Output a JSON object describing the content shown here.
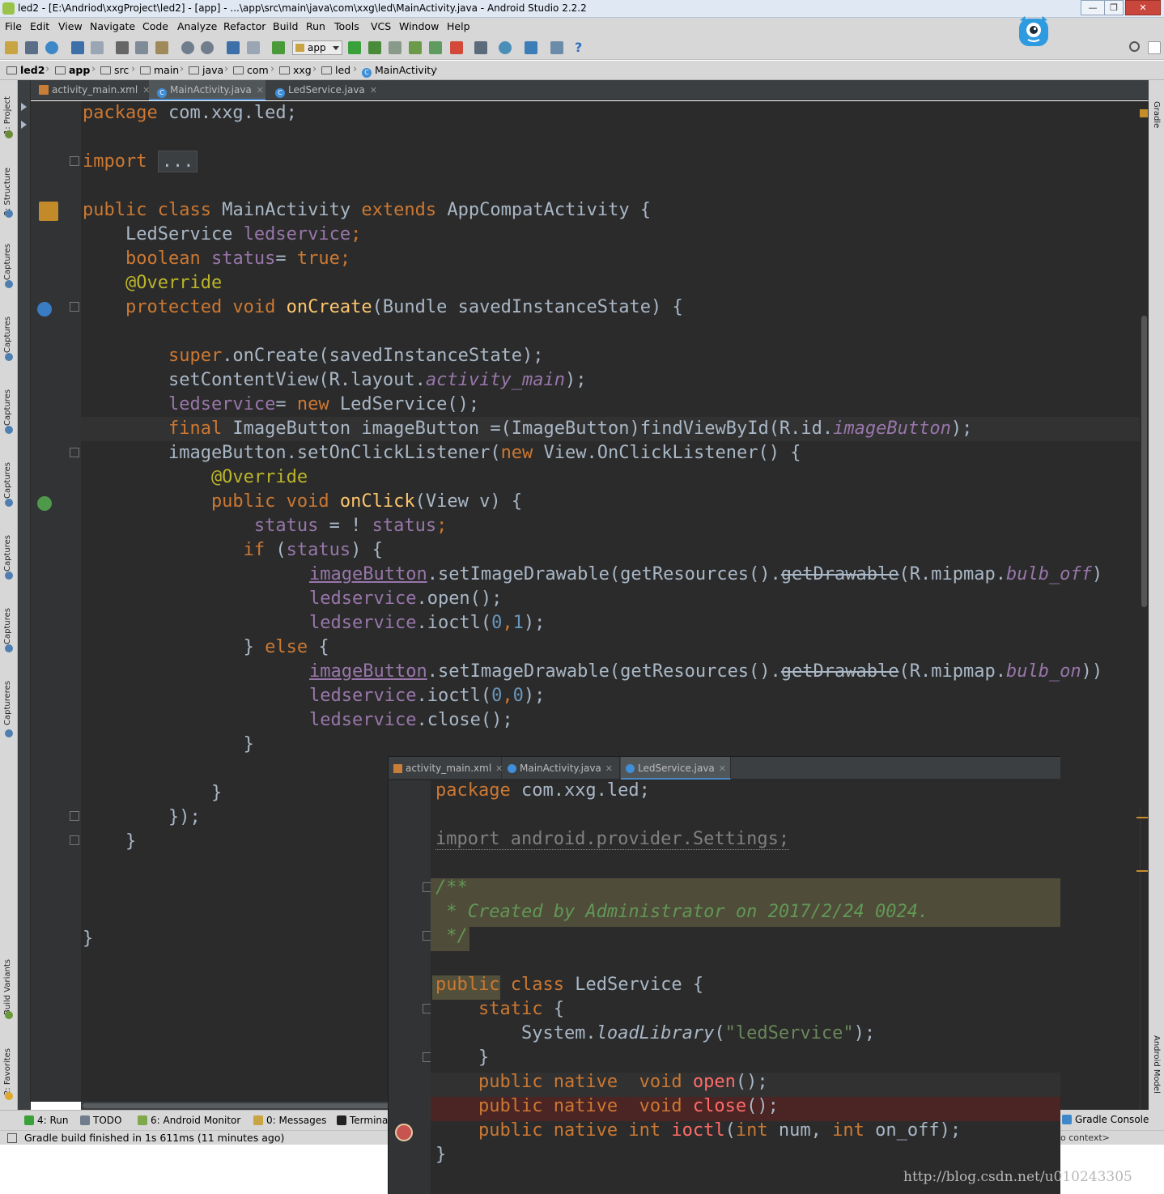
{
  "window": {
    "title": "led2 - [E:\\Andriod\\xxgProject\\led2] - [app] - ...\\app\\src\\main\\java\\com\\xxg\\led\\MainActivity.java - Android Studio 2.2.2",
    "min_label": "—",
    "max_label": "❐",
    "close_label": "✕"
  },
  "menu": [
    "File",
    "Edit",
    "View",
    "Navigate",
    "Code",
    "Analyze",
    "Refactor",
    "Build",
    "Run",
    "Tools",
    "VCS",
    "Window",
    "Help"
  ],
  "toolbar": {
    "config_select": "app",
    "icons": [
      "open-icon",
      "save-icon",
      "sync-icon",
      "undo-icon",
      "redo-icon",
      "cut-icon",
      "copy-icon",
      "paste-icon",
      "find-icon",
      "replace-icon",
      "back-icon",
      "forward-icon",
      "make-icon",
      "run-icon",
      "debug-icon",
      "coverage-icon",
      "apply-changes-icon",
      "attach-debugger-icon",
      "stop-icon",
      "avd-manager-icon",
      "sdk-manager-icon",
      "sync-gradle-icon",
      "project-structure-icon",
      "device-monitor-icon",
      "help-icon",
      "search-everywhere-icon"
    ]
  },
  "breadcrumb": [
    "led2",
    "app",
    "src",
    "main",
    "java",
    "com",
    "xxg",
    "led",
    "MainActivity"
  ],
  "left_tools": [
    "1: Project",
    "2: Structure",
    "Captures",
    "Captures",
    "Captures",
    "Captures",
    "Captures",
    "Captures",
    "Captureres",
    "Build Variants",
    "2: Favorites"
  ],
  "right_tools": [
    "Gradle",
    "Android Model"
  ],
  "editor_tabs": [
    {
      "label": "activity_main.xml",
      "type": "xml"
    },
    {
      "label": "MainActivity.java",
      "type": "class"
    },
    {
      "label": "LedService.java",
      "type": "class"
    }
  ],
  "main_code": {
    "l1_kw": "package",
    "l1_rest": " com.xxg.led;",
    "l3_kw": "import",
    "l3_fold": "...",
    "l5_kw1": "public",
    "l5_kw2": "class",
    "l5_name": "MainActivity",
    "l5_kw3": "extends",
    "l5_rest": "AppCompatActivity {",
    "l6_type": "    LedService ",
    "l6_field": "ledservice",
    "l6_semi": ";",
    "l7_kw": "    boolean",
    "l7_field": " status",
    "l7_eq": "= ",
    "l7_val": "true",
    "l7_semi": ";",
    "l8_ann": "    @Override",
    "l9_kw1": "    protected",
    "l9_kw2": " void",
    "l9_m": " onCreate",
    "l9_rest": "(Bundle savedInstanceState) {",
    "l11_kw": "        super",
    "l11_rest": ".onCreate(savedInstanceState);",
    "l12_a": "        setContentView(R.layout.",
    "l12_f": "activity_main",
    "l12_b": ");",
    "l13_f": "        ledservice",
    "l13_eq": "= ",
    "l13_kw": "new",
    "l13_rest": " LedService();",
    "l14_kw": "        final",
    "l14_a": " ImageButton imageButton =(ImageButton)findViewById(R.id.",
    "l14_f": "imageButton",
    "l14_b": ");",
    "l15_a": "        imageButton.setOnClickListener(",
    "l15_kw": "new",
    "l15_b": " View.OnClickListener() {",
    "l16_ann": "            @Override",
    "l17_kw1": "            public",
    "l17_kw2": " void",
    "l17_m": " onClick",
    "l17_rest": "(View v) {",
    "l18_f1": "                status",
    "l18_mid": " = ! ",
    "l18_f2": "status",
    "l18_semi": ";",
    "l19_kw": "               if",
    "l19_a": " (",
    "l19_f": "status",
    "l19_b": ") {",
    "l20_f": "imageButton",
    "l20_a": ".setImageDrawable(getResources().",
    "l20_st": "getDrawable",
    "l20_b": "(R.mipmap.",
    "l20_i": "bulb_off",
    "l20_c": ")",
    "l21_f": "ledservice",
    "l21_rest": ".open();",
    "l22_f": "ledservice",
    "l22_a": ".ioctl(",
    "l22_n1": "0",
    "l22_comma": ",",
    "l22_n2": "1",
    "l22_b": ");",
    "l23_a": "               } ",
    "l23_kw": "else",
    "l23_b": " {",
    "l24_f": "imageButton",
    "l24_a": ".setImageDrawable(getResources().",
    "l24_st": "getDrawable",
    "l24_b": "(R.mipmap.",
    "l24_i": "bulb_on",
    "l24_c": "))",
    "l25_f": "ledservice",
    "l25_a": ".ioctl(",
    "l25_n1": "0",
    "l25_comma": ",",
    "l25_n2": "0",
    "l25_b": ");",
    "l26_f": "ledservice",
    "l26_rest": ".close();",
    "l27": "               }",
    "l29": "            }",
    "l30": "        });",
    "l31": "    }",
    "l35": "}"
  },
  "overlay": {
    "tabs": [
      {
        "label": "activity_main.xml",
        "type": "xml"
      },
      {
        "label": "MainActivity.java",
        "type": "class"
      },
      {
        "label": "LedService.java",
        "type": "class"
      }
    ],
    "code": {
      "o1_kw": "package",
      "o1_rest": " com.xxg.led;",
      "o3": "import android.provider.Settings;",
      "o5": "/**",
      "o6": " * Created by Administrator on 2017/2/24 0024.",
      "o7": " */",
      "o9_kw1": "public",
      "o9_kw2": " class",
      "o9_rest": " LedService {",
      "o10_kw": "    static",
      "o10_rest": " {",
      "o11_a": "        System.",
      "o11_m": "loadLibrary",
      "o11_b": "(",
      "o11_s": "\"ledService\"",
      "o11_c": ");",
      "o12": "    }",
      "o13_kw": "    public native  void",
      "o13_m": " open",
      "o13_rest": "();",
      "o14_kw": "    public native  void",
      "o14_m": " close",
      "o14_rest": "();",
      "o15_kw": "    public native int",
      "o15_m": " ioctl",
      "o15_a": "(",
      "o15_kw2": "int",
      "o15_b": " num, ",
      "o15_kw3": "int",
      "o15_c": " on_off);",
      "o16": "}"
    }
  },
  "bottom_tools": [
    {
      "label": "4: Run",
      "icon": "run-icon"
    },
    {
      "label": "TODO",
      "icon": "todo-icon"
    },
    {
      "label": "6: Android Monitor",
      "icon": "android-icon"
    },
    {
      "label": "0: Messages",
      "icon": "messages-icon"
    },
    {
      "label": "Terminal",
      "icon": "terminal-icon"
    },
    {
      "label": "Gradle Console",
      "icon": "gradle-icon"
    }
  ],
  "status": {
    "text": "Gradle build finished in 1s 611ms (11 minutes ago)",
    "context": "o context>"
  },
  "watermark": "http://blog.csdn.net/u010243305",
  "colors": {
    "keyword": "#cc7832",
    "field": "#9876aa",
    "annotation": "#bbb529",
    "method": "#ffc66d",
    "number": "#6897bb",
    "string": "#6a8759",
    "doc_comment": "#629755",
    "editor_bg": "#2b2b2b",
    "gutter_bg": "#313335"
  }
}
